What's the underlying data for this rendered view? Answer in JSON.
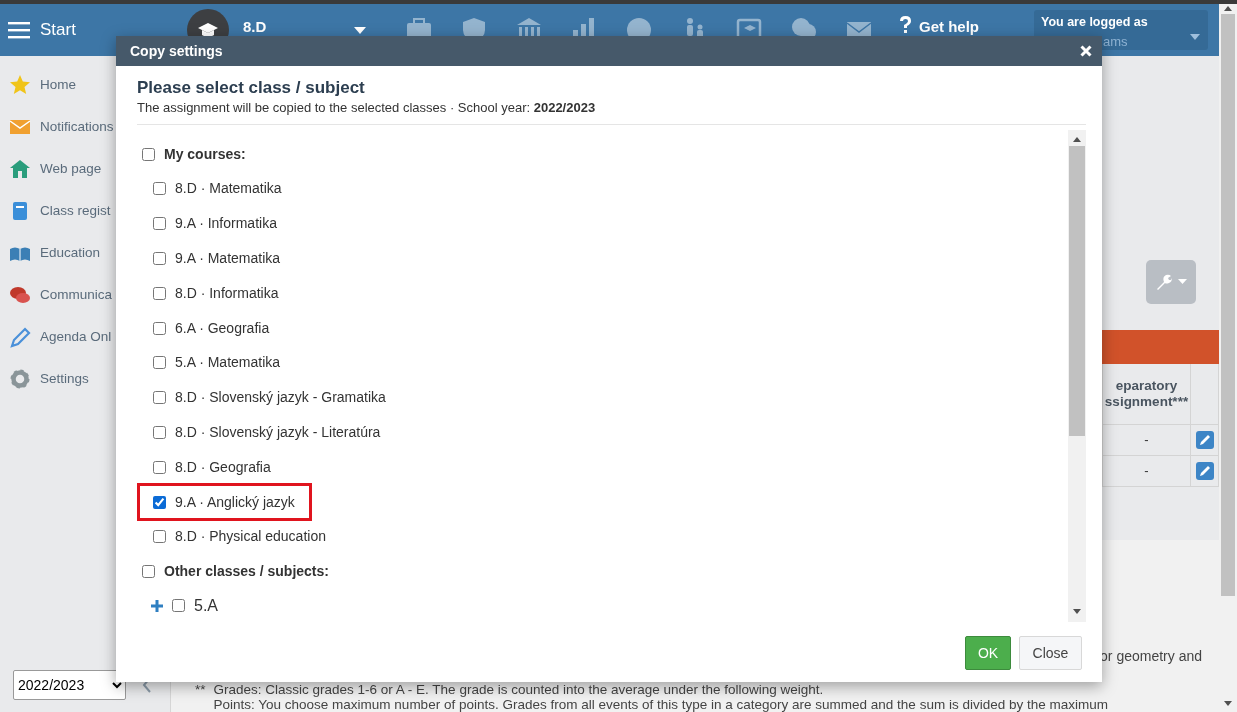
{
  "header": {
    "menu_label": "Start",
    "class_name": "8.D",
    "help_label": "Get help",
    "account": {
      "label": "You are logged as",
      "user": "ams"
    }
  },
  "sidebar": {
    "items": [
      {
        "label": "Home"
      },
      {
        "label": "Notifications"
      },
      {
        "label": "Web page"
      },
      {
        "label": "Class regist"
      },
      {
        "label": "Education"
      },
      {
        "label": "Communica"
      },
      {
        "label": "Agenda Onl"
      },
      {
        "label": "Settings"
      }
    ],
    "year_select": "2022/2023"
  },
  "content": {
    "table": {
      "header_lines": [
        "eparatory",
        "ssignment***"
      ],
      "rows": [
        {
          "value": "-"
        },
        {
          "value": "-"
        }
      ]
    },
    "note_tail": "or geometry and",
    "footnotes": [
      {
        "mark": "**",
        "lines": [
          "Grades: Classic grades 1-6 or A - E. The grade is counted into the average under the following weight.",
          "Points: You choose maximum number of points. Grades from all events of this type in a category are summed and the sum is divided by the maximum"
        ]
      }
    ]
  },
  "dialog": {
    "title": "Copy settings",
    "heading": "Please select class / subject",
    "subtitle": "The assignment will be copied to the selected classes · School year: **2022/2023**",
    "groups": [
      {
        "label": "My courses:",
        "checked": false,
        "items": [
          {
            "label": "8.D · Matematika",
            "kind": "course",
            "checked": false,
            "highlighted": false
          },
          {
            "label": "9.A · Informatika",
            "kind": "course",
            "checked": false,
            "highlighted": false
          },
          {
            "label": "9.A · Matematika",
            "kind": "course",
            "checked": false,
            "highlighted": false
          },
          {
            "label": "8.D · Informatika",
            "kind": "course",
            "checked": false,
            "highlighted": false
          },
          {
            "label": "6.A · Geografia",
            "kind": "course",
            "checked": false,
            "highlighted": false
          },
          {
            "label": "5.A · Matematika",
            "kind": "course",
            "checked": false,
            "highlighted": false
          },
          {
            "label": "8.D · Slovenský jazyk - Gramatika",
            "kind": "course",
            "checked": false,
            "highlighted": false
          },
          {
            "label": "8.D · Slovenský jazyk - Literatúra",
            "kind": "course",
            "checked": false,
            "highlighted": false
          },
          {
            "label": "8.D · Geografia",
            "kind": "course",
            "checked": false,
            "highlighted": false
          },
          {
            "label": "9.A · Anglický jazyk",
            "kind": "course",
            "checked": true,
            "highlighted": true
          },
          {
            "label": "8.D · Physical education",
            "kind": "course",
            "checked": false,
            "highlighted": false
          }
        ]
      },
      {
        "label": "Other classes / subjects:",
        "checked": false,
        "items": [
          {
            "label": "5.A",
            "kind": "class",
            "checked": false,
            "highlighted": false
          }
        ]
      }
    ],
    "buttons": [
      {
        "label": "OK",
        "kind": "primary"
      },
      {
        "label": "Close",
        "kind": "secondary"
      }
    ]
  }
}
